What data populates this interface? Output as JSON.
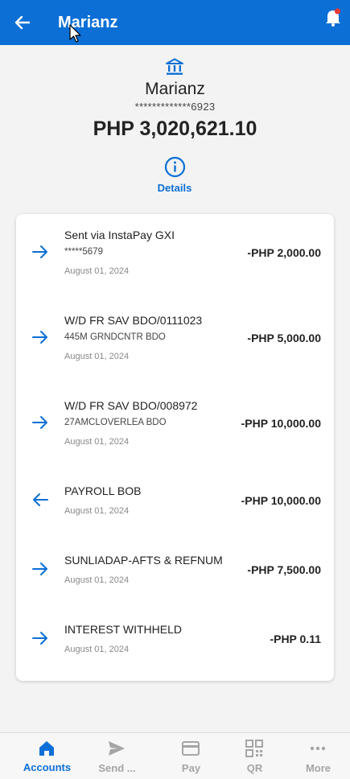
{
  "header": {
    "title": "Marianz",
    "back_icon": "arrow-left-icon",
    "bell_icon": "bell-icon",
    "bell_badge_color": "#e53935"
  },
  "account": {
    "icon": "bank-icon",
    "name": "Marianz",
    "number": "*************6923",
    "balance": "PHP 3,020,621.10",
    "details_icon": "info-icon",
    "details_label": "Details"
  },
  "transactions": [
    {
      "direction": "out",
      "title": "Sent via InstaPay GXI",
      "sub": "*****5679",
      "date": "August 01, 2024",
      "amount": "-PHP 2,000.00"
    },
    {
      "direction": "out",
      "title": "W/D FR SAV BDO/0111023",
      "sub": "445M GRNDCNTR BDO",
      "date": "August 01, 2024",
      "amount": "-PHP 5,000.00"
    },
    {
      "direction": "out",
      "title": "W/D FR SAV BDO/008972",
      "sub": "27AMCLOVERLEA BDO",
      "date": "August 01, 2024",
      "amount": "-PHP 10,000.00"
    },
    {
      "direction": "in",
      "title": "PAYROLL BOB",
      "sub": "",
      "date": "August 01, 2024",
      "amount": "-PHP 10,000.00"
    },
    {
      "direction": "out",
      "title": "SUNLIADAP-AFTS & REFNUM",
      "sub": "",
      "date": "August 01, 2024",
      "amount": "-PHP 7,500.00"
    },
    {
      "direction": "out",
      "title": "INTEREST WITHHELD",
      "sub": "",
      "date": "August 01, 2024",
      "amount": "-PHP 0.11"
    }
  ],
  "bottom_nav": [
    {
      "label": "Accounts",
      "icon": "home-icon",
      "active": true
    },
    {
      "label": "Send ...",
      "icon": "send-icon",
      "active": false
    },
    {
      "label": "Pay",
      "icon": "card-icon",
      "active": false
    },
    {
      "label": "QR",
      "icon": "qr-icon",
      "active": false
    },
    {
      "label": "More",
      "icon": "more-icon",
      "active": false
    }
  ],
  "colors": {
    "brand": "#0b6fd6",
    "inactive_nav": "#a5a5a5"
  }
}
